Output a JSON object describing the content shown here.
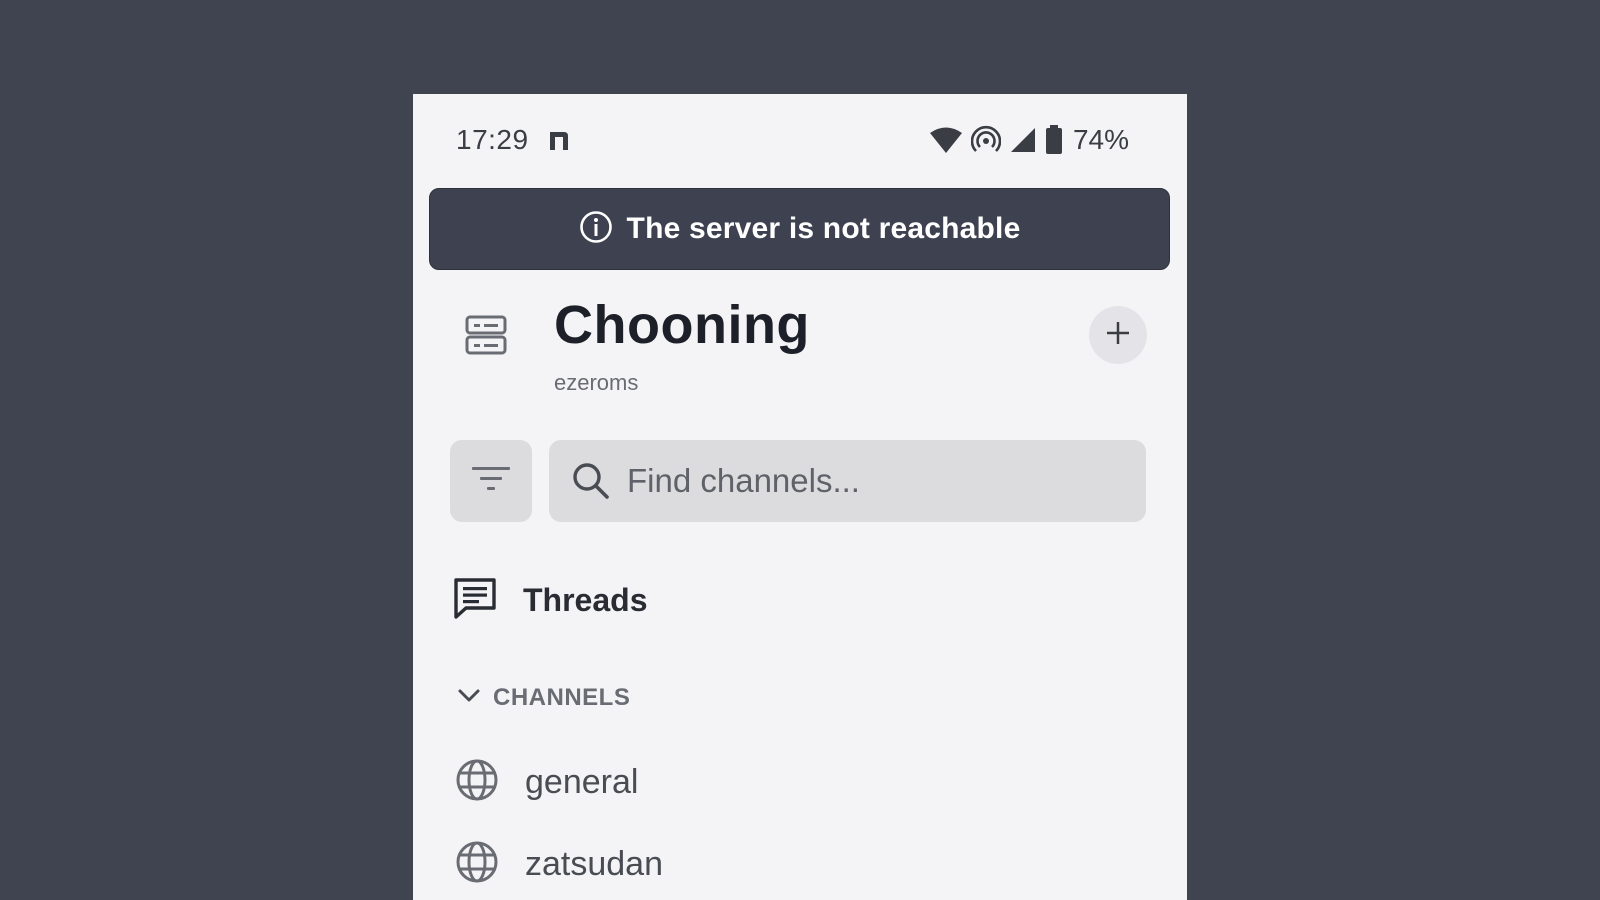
{
  "status_bar": {
    "time": "17:29",
    "battery": "74%"
  },
  "banner": {
    "message": "The server is not reachable",
    "icon": "info-icon"
  },
  "header": {
    "title": "Chooning",
    "subtitle": "ezeroms",
    "server_icon": "server-icon",
    "add_icon": "plus-icon"
  },
  "search": {
    "placeholder": "Find channels...",
    "value": "",
    "filter_icon": "filter-icon"
  },
  "threads": {
    "label": "Threads",
    "icon": "threads-icon"
  },
  "channels": {
    "section_label": "CHANNELS",
    "items": [
      {
        "label": "general",
        "icon": "globe-icon"
      },
      {
        "label": "zatsudan",
        "icon": "globe-icon"
      }
    ]
  },
  "colors": {
    "background": "#404350",
    "panel": "#f4f4f6",
    "banner": "#3e4250",
    "input": "#dcdcde"
  }
}
